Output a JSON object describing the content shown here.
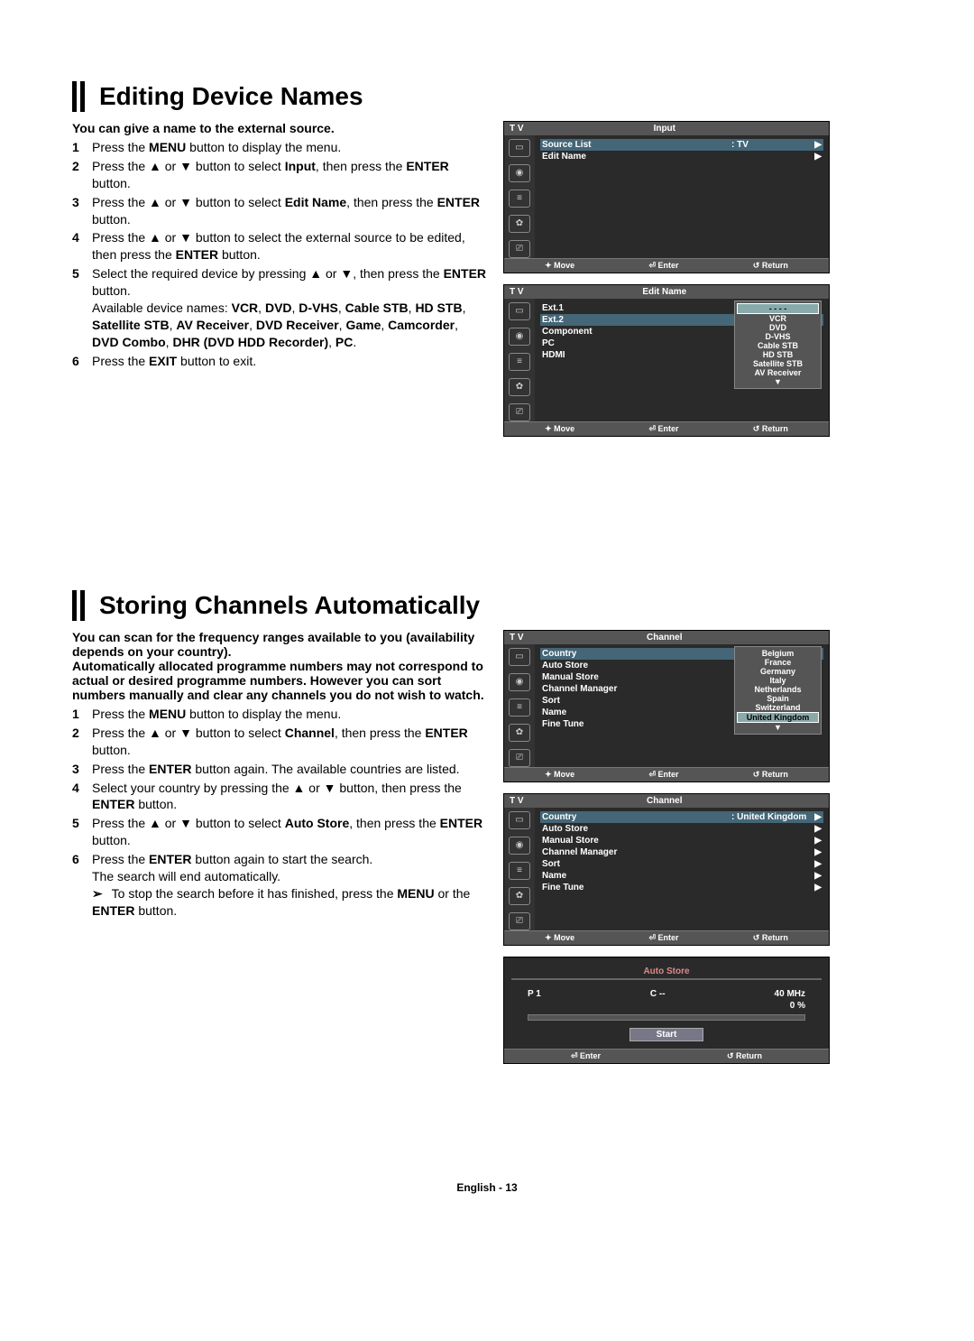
{
  "section1": {
    "title": "Editing Device Names",
    "intro": "You can give a name to the external source.",
    "steps": [
      "Press the <b>MENU</b> button to display the menu.",
      "Press the ▲ or ▼ button to select <b>Input</b>, then press the <b>ENTER</b> button.",
      "Press the ▲ or ▼ button to select <b>Edit Name</b>, then press the <b>ENTER</b> button.",
      "Press the ▲ or ▼ button to select the external source to be edited, then press the <b>ENTER</b> button.",
      "Select the required device by pressing ▲ or ▼, then press the <b>ENTER</b> button.<br>Available device names: <b>VCR</b>, <b>DVD</b>, <b>D-VHS</b>, <b>Cable STB</b>, <b>HD STB</b>, <b>Satellite STB</b>, <b>AV Receiver</b>, <b>DVD Receiver</b>, <b>Game</b>, <b>Camcorder</b>, <b>DVD Combo</b>, <b>DHR (DVD HDD Recorder)</b>, <b>PC</b>.",
      "Press the <b>EXIT</b> button to exit."
    ]
  },
  "osd_input": {
    "corner": "T V",
    "title": "Input",
    "rows": [
      {
        "label": "Source List",
        "value": ": TV",
        "arrow": "▶",
        "sel": true
      },
      {
        "label": "Edit Name",
        "value": "",
        "arrow": "▶",
        "sel": false
      }
    ],
    "footer": [
      "✦ Move",
      "⏎ Enter",
      "↺ Return"
    ]
  },
  "osd_editname": {
    "corner": "T V",
    "title": "Edit Name",
    "rows": [
      {
        "label": "Ext.1",
        "colon": ":",
        "sel": false
      },
      {
        "label": "Ext.2",
        "colon": ":",
        "sel": true
      },
      {
        "label": "Component",
        "colon": ":",
        "sel": false
      },
      {
        "label": "PC",
        "colon": ":",
        "sel": false
      },
      {
        "label": "HDMI",
        "colon": ":",
        "sel": false
      }
    ],
    "popup": [
      "- - - -",
      "VCR",
      "DVD",
      "D-VHS",
      "Cable STB",
      "HD STB",
      "Satellite STB",
      "AV Receiver",
      "▼"
    ],
    "popup_sel_index": 0,
    "footer": [
      "✦ Move",
      "⏎ Enter",
      "↺ Return"
    ]
  },
  "section2": {
    "title": "Storing Channels Automatically",
    "intro": "You can scan for the frequency ranges available to you (availability depends on your country).\nAutomatically allocated programme numbers may not correspond to actual or desired programme numbers. However you can sort numbers manually and clear any channels you do not wish to watch.",
    "steps": [
      "Press the <b>MENU</b> button to display the menu.",
      "Press the ▲ or ▼ button to select <b>Channel</b>, then press the <b>ENTER</b> button.",
      "Press the <b>ENTER</b> button again. The available countries are listed.",
      "Select your country by pressing the ▲ or ▼ button, then press the <b>ENTER</b> button.",
      "Press the ▲ or ▼ button to select <b>Auto Store</b>, then press the <b>ENTER</b> button.",
      "Press the <b>ENTER</b> button again to start the search.<br>The search will end automatically.<br><span class='note-arrow'>➢</span> To stop the search before it has finished, press the <b>MENU</b> or the <b>ENTER</b> button."
    ]
  },
  "osd_channel_country": {
    "corner": "T V",
    "title": "Channel",
    "rows": [
      {
        "label": "Country",
        "colon": ":",
        "sel": true
      },
      {
        "label": "Auto Store",
        "colon": "",
        "sel": false
      },
      {
        "label": "Manual Store",
        "colon": "",
        "sel": false
      },
      {
        "label": "Channel Manager",
        "colon": "",
        "sel": false
      },
      {
        "label": "Sort",
        "colon": "",
        "sel": false
      },
      {
        "label": "Name",
        "colon": "",
        "sel": false
      },
      {
        "label": "Fine Tune",
        "colon": "",
        "sel": false
      }
    ],
    "popup": [
      "Belgium",
      "France",
      "Germany",
      "Italy",
      "Netherlands",
      "Spain",
      "Switzerland",
      "United Kingdom",
      "▼"
    ],
    "popup_sel_index": 7,
    "footer": [
      "✦ Move",
      "⏎ Enter",
      "↺ Return"
    ]
  },
  "osd_channel_main": {
    "corner": "T V",
    "title": "Channel",
    "rows": [
      {
        "label": "Country",
        "value": ": United Kingdom",
        "arrow": "▶",
        "sel": true
      },
      {
        "label": "Auto Store",
        "value": "",
        "arrow": "▶",
        "sel": false
      },
      {
        "label": "Manual Store",
        "value": "",
        "arrow": "▶",
        "sel": false
      },
      {
        "label": "Channel Manager",
        "value": "",
        "arrow": "▶",
        "sel": false
      },
      {
        "label": "Sort",
        "value": "",
        "arrow": "▶",
        "sel": false
      },
      {
        "label": "Name",
        "value": "",
        "arrow": "▶",
        "sel": false
      },
      {
        "label": "Fine Tune",
        "value": "",
        "arrow": "▶",
        "sel": false
      }
    ],
    "footer": [
      "✦ Move",
      "⏎ Enter",
      "↺ Return"
    ]
  },
  "osd_autostore": {
    "title": "Auto Store",
    "p_label": "P  1",
    "c_label": "C   --",
    "mhz": "40  MHz",
    "percent": "0  %",
    "start": "Start",
    "footer": [
      "⏎ Enter",
      "↺ Return"
    ]
  },
  "footer": "English - 13"
}
